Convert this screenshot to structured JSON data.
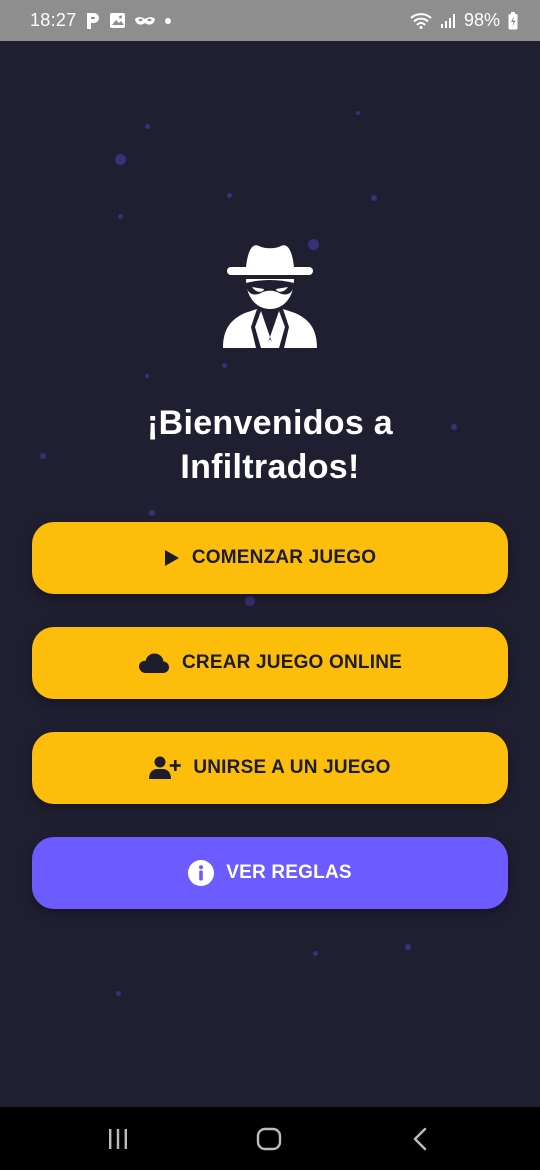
{
  "status_bar": {
    "time": "18:27",
    "battery": "98%",
    "icons": [
      "parking-icon",
      "gallery-icon",
      "eye-mask-icon",
      "notification-dot-icon",
      "wifi-icon",
      "signal-icon",
      "battery-charging-icon"
    ]
  },
  "app": {
    "logo_icon": "spy-icon",
    "title_line1": "¡Bienvenidos a",
    "title_line2": "Infiltrados!",
    "buttons": {
      "start": {
        "label": "COMENZAR JUEGO",
        "icon": "play-icon"
      },
      "create_online": {
        "label": "CREAR JUEGO ONLINE",
        "icon": "cloud-icon"
      },
      "join": {
        "label": "UNIRSE A UN JUEGO",
        "icon": "add-user-icon"
      },
      "rules": {
        "label": "VER REGLAS",
        "icon": "info-icon"
      }
    }
  },
  "nav_bar": {
    "items": [
      "recent-apps-icon",
      "home-icon",
      "back-icon"
    ]
  },
  "colors": {
    "background": "#1f1f31",
    "primary_button": "#fcbd0b",
    "secondary_button": "#6c5bff",
    "dots": "#3a2f7a"
  }
}
